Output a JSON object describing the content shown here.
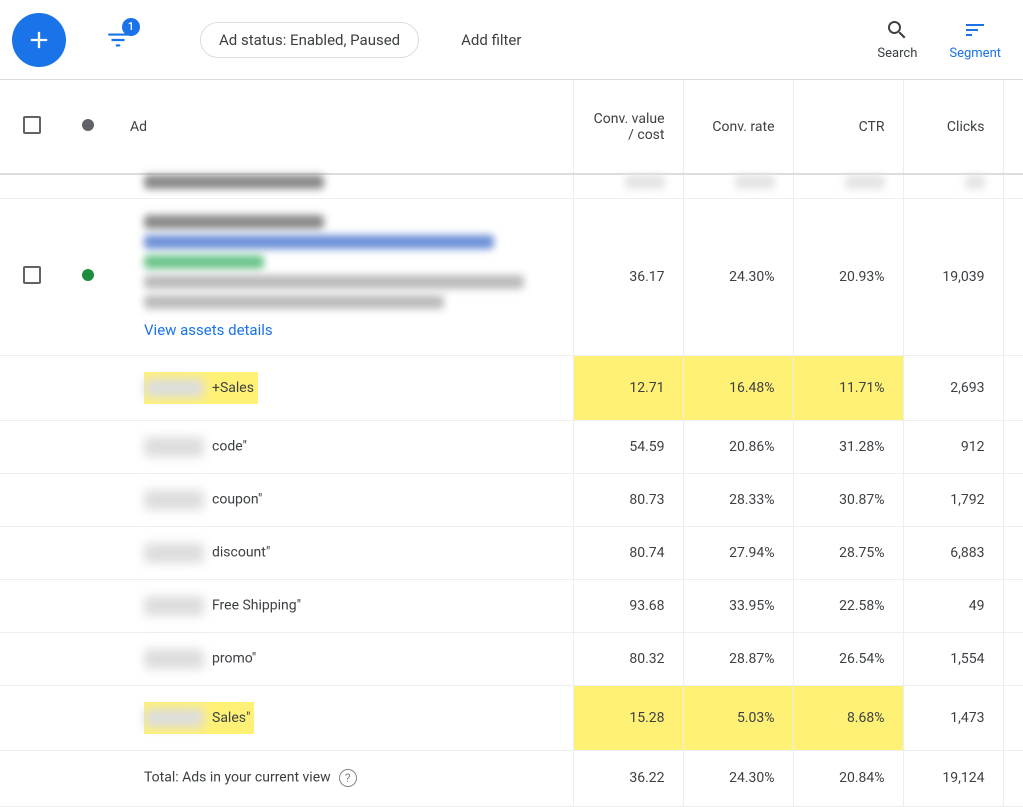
{
  "toolbar": {
    "filter_badge": "1",
    "status_filter": "Ad status: Enabled, Paused",
    "add_filter": "Add filter",
    "search_label": "Search",
    "segment_label": "Segment"
  },
  "columns": {
    "ad": "Ad",
    "conv_value_cost": "Conv. value / cost",
    "conv_rate": "Conv. rate",
    "ctr": "CTR",
    "clicks": "Clicks"
  },
  "main_row": {
    "link": "View assets details",
    "conv_value_cost": "36.17",
    "conv_rate": "24.30%",
    "ctr": "20.93%",
    "clicks": "19,039"
  },
  "rows": [
    {
      "label": "+Sales",
      "conv_value_cost": "12.71",
      "conv_rate": "16.48%",
      "ctr": "11.71%",
      "clicks": "2,693",
      "highlighted": true
    },
    {
      "label": "code\"",
      "conv_value_cost": "54.59",
      "conv_rate": "20.86%",
      "ctr": "31.28%",
      "clicks": "912",
      "highlighted": false
    },
    {
      "label": "coupon\"",
      "conv_value_cost": "80.73",
      "conv_rate": "28.33%",
      "ctr": "30.87%",
      "clicks": "1,792",
      "highlighted": false
    },
    {
      "label": "discount\"",
      "conv_value_cost": "80.74",
      "conv_rate": "27.94%",
      "ctr": "28.75%",
      "clicks": "6,883",
      "highlighted": false
    },
    {
      "label": "Free Shipping\"",
      "conv_value_cost": "93.68",
      "conv_rate": "33.95%",
      "ctr": "22.58%",
      "clicks": "49",
      "highlighted": false
    },
    {
      "label": "promo\"",
      "conv_value_cost": "80.32",
      "conv_rate": "28.87%",
      "ctr": "26.54%",
      "clicks": "1,554",
      "highlighted": false
    },
    {
      "label": "Sales\"",
      "conv_value_cost": "15.28",
      "conv_rate": "5.03%",
      "ctr": "8.68%",
      "clicks": "1,473",
      "highlighted": true
    }
  ],
  "total_row": {
    "label": "Total: Ads in your current view",
    "conv_value_cost": "36.22",
    "conv_rate": "24.30%",
    "ctr": "20.84%",
    "clicks": "19,124"
  }
}
